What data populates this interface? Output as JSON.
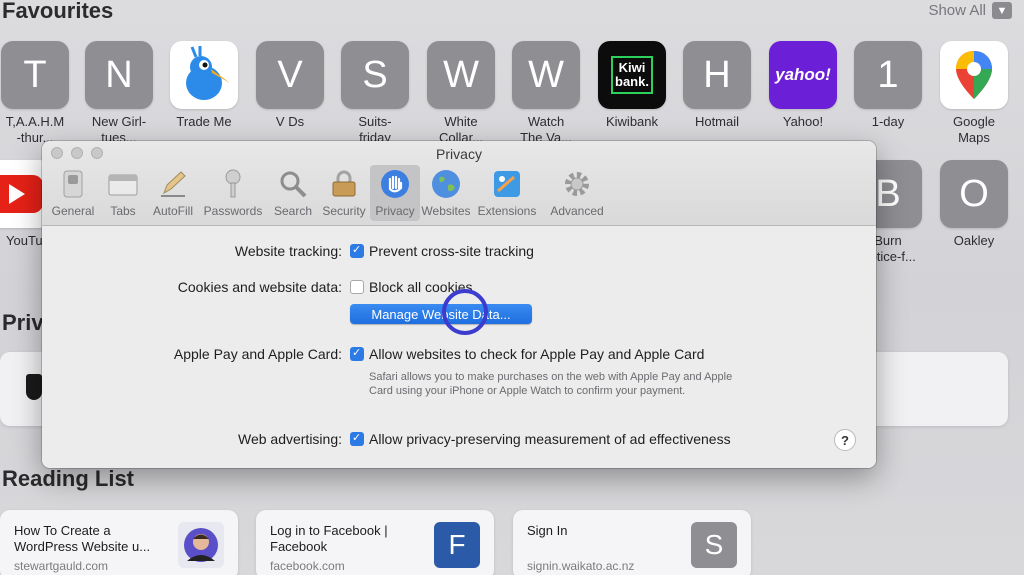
{
  "favourites": {
    "title": "Favourites",
    "show_all": "Show All",
    "row1": [
      {
        "letter": "T",
        "label": "T,A.A.H.M",
        "label2": "-thur..."
      },
      {
        "letter": "N",
        "label": "New Girl-",
        "label2": "tues..."
      },
      {
        "letter": "",
        "label": "Trade Me",
        "label2": ""
      },
      {
        "letter": "V",
        "label": "V Ds",
        "label2": ""
      },
      {
        "letter": "S",
        "label": "Suits-",
        "label2": "friday"
      },
      {
        "letter": "W",
        "label": "White",
        "label2": "Collar..."
      },
      {
        "letter": "W",
        "label": "Watch",
        "label2": "The Va..."
      },
      {
        "letter": "",
        "label": "Kiwibank",
        "label2": ""
      },
      {
        "letter": "H",
        "label": "Hotmail",
        "label2": ""
      },
      {
        "letter": "",
        "label": "Yahoo!",
        "label2": ""
      },
      {
        "letter": "1",
        "label": "1-day",
        "label2": ""
      },
      {
        "letter": "",
        "label": "Google",
        "label2": "Maps"
      }
    ],
    "row2": [
      {
        "letter": "",
        "label": "YouTu...",
        "label2": ""
      },
      {
        "letter": "B",
        "label": "Burn",
        "label2": "Notice-f..."
      },
      {
        "letter": "O",
        "label": "Oakley",
        "label2": ""
      }
    ],
    "kiwibank_logo": "Kiwi bank.",
    "yahoo_logo": "yahoo!"
  },
  "privacy_report": {
    "title": "Priv"
  },
  "reading_list": {
    "title": "Reading List",
    "items": [
      {
        "title": "How To Create a WordPress Website u...",
        "url": "stewartgauld.com",
        "thumb": ""
      },
      {
        "title": "Log in to Facebook | Facebook",
        "url": "facebook.com",
        "thumb": "F"
      },
      {
        "title": "Sign In",
        "url": "signin.waikato.ac.nz",
        "thumb": "S"
      }
    ]
  },
  "window": {
    "title": "Privacy",
    "toolbar": [
      {
        "label": "General",
        "icon": "switch-icon"
      },
      {
        "label": "Tabs",
        "icon": "tabs-icon"
      },
      {
        "label": "AutoFill",
        "icon": "pencil-icon"
      },
      {
        "label": "Passwords",
        "icon": "key-icon"
      },
      {
        "label": "Search",
        "icon": "magnifier-icon"
      },
      {
        "label": "Security",
        "icon": "lock-icon"
      },
      {
        "label": "Privacy",
        "icon": "hand-icon"
      },
      {
        "label": "Websites",
        "icon": "globe-icon"
      },
      {
        "label": "Extensions",
        "icon": "puzzle-icon"
      },
      {
        "label": "Advanced",
        "icon": "gear-icon"
      }
    ],
    "tracking_label": "Website tracking:",
    "tracking_option": "Prevent cross-site tracking",
    "cookies_label": "Cookies and website data:",
    "cookies_option": "Block all cookies",
    "manage_button": "Manage Website Data...",
    "applepay_label": "Apple Pay and Apple Card:",
    "applepay_option": "Allow websites to check for Apple Pay and Apple Card",
    "applepay_desc": "Safari allows you to make purchases on the web with Apple Pay and Apple Card using your iPhone or Apple Watch to confirm your payment.",
    "advertising_label": "Web advertising:",
    "advertising_option": "Allow privacy-preserving measurement of ad effectiveness",
    "help": "?"
  },
  "colors": {
    "accent": "#2c7be5",
    "tile_gray": "#8e8e93",
    "yahoo": "#6b1fd6",
    "facebook": "#2b5aa8"
  }
}
